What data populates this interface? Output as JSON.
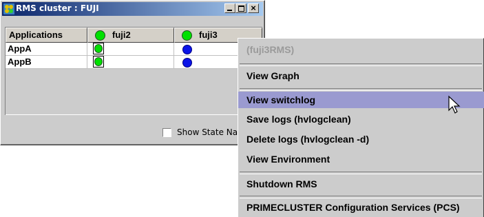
{
  "window": {
    "title": "RMS cluster : FUJI",
    "icon": "cluster-app-icon",
    "controls": [
      "minimize",
      "maximize",
      "close"
    ]
  },
  "table": {
    "columns": [
      "Applications",
      "fuji2",
      "fuji3"
    ],
    "header_node_icons": [
      "online-green-dot-icon",
      "online-green-dot-icon"
    ],
    "rows": [
      {
        "name": "AppA",
        "fuji2": "online",
        "fuji3": "offline"
      },
      {
        "name": "AppB",
        "fuji2": "online",
        "fuji3": "offline"
      }
    ]
  },
  "show_state_names": {
    "label": "Show State Na",
    "checked": false
  },
  "context_menu": {
    "items": [
      {
        "label": "(fuji3RMS)",
        "enabled": false
      },
      {
        "label": "View Graph",
        "enabled": true
      },
      {
        "label": "View switchlog",
        "enabled": true,
        "highlighted": true
      },
      {
        "label": "Save logs (hvlogclean)",
        "enabled": true
      },
      {
        "label": "Delete logs (hvlogclean -d)",
        "enabled": true
      },
      {
        "label": "View Environment",
        "enabled": true
      },
      {
        "label": "Shutdown RMS",
        "enabled": true
      },
      {
        "label": "PRIMECLUSTER Configuration Services (PCS)",
        "enabled": true
      }
    ]
  },
  "colors": {
    "online": "#00e000",
    "offline": "#0a14e8",
    "menu_highlight": "#9a9ad0",
    "titlebar_start": "#0a246a"
  }
}
